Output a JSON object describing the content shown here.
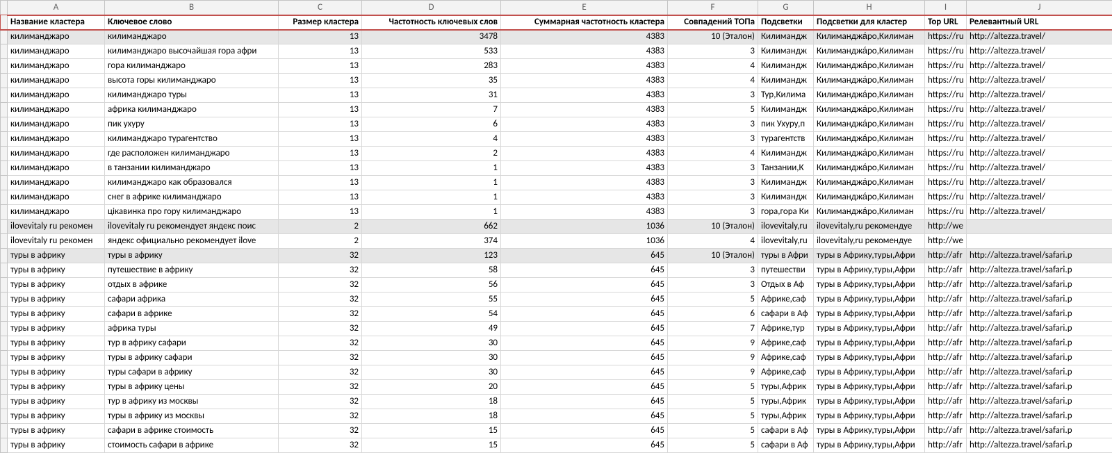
{
  "columns": [
    "A",
    "B",
    "C",
    "D",
    "E",
    "F",
    "G",
    "H",
    "I",
    "J"
  ],
  "headers": {
    "A": "Название кластера",
    "B": "Ключевое слово",
    "C": "Размер кластера",
    "D": "Частотность ключевых слов",
    "E": "Суммарная частотность кластера",
    "F": "Совпадений ТОПа",
    "G": "Подсветки",
    "H": "Подсветки для кластер",
    "I": "Top URL",
    "J": "Релевантный URL"
  },
  "rows": [
    {
      "shade": true,
      "A": "килиманджаро",
      "B": "килиманджаро",
      "C": "13",
      "D": "3478",
      "E": "4383",
      "F": "10 (Эталон)",
      "G": "Килимандж",
      "H": "Килиманджа́ро,Килиман",
      "I": "https://ru",
      "J": "http://altezza.travel/"
    },
    {
      "A": "килиманджаро",
      "B": "килиманджаро высочайшая гора афри",
      "C": "13",
      "D": "533",
      "E": "4383",
      "F": "3",
      "G": "Килимандж",
      "H": "Килиманджа́ро,Килиман",
      "I": "https://ru",
      "J": "http://altezza.travel/"
    },
    {
      "A": "килиманджаро",
      "B": "гора килиманджаро",
      "C": "13",
      "D": "283",
      "E": "4383",
      "F": "4",
      "G": "Килимандж",
      "H": "Килиманджа́ро,Килиман",
      "I": "https://ru",
      "J": "http://altezza.travel/"
    },
    {
      "A": "килиманджаро",
      "B": "высота горы килиманджаро",
      "C": "13",
      "D": "35",
      "E": "4383",
      "F": "4",
      "G": "Килимандж",
      "H": "Килиманджа́ро,Килиман",
      "I": "https://ru",
      "J": "http://altezza.travel/"
    },
    {
      "A": "килиманджаро",
      "B": "килиманджаро туры",
      "C": "13",
      "D": "31",
      "E": "4383",
      "F": "3",
      "G": "Тур,Килима",
      "H": "Килиманджа́ро,Килиман",
      "I": "https://ru",
      "J": "http://altezza.travel/"
    },
    {
      "A": "килиманджаро",
      "B": "африка килиманджаро",
      "C": "13",
      "D": "7",
      "E": "4383",
      "F": "5",
      "G": "Килимандж",
      "H": "Килиманджа́ро,Килиман",
      "I": "https://ru",
      "J": "http://altezza.travel/"
    },
    {
      "A": "килиманджаро",
      "B": "пик ухуру",
      "C": "13",
      "D": "6",
      "E": "4383",
      "F": "3",
      "G": "пик Ухуру,п",
      "H": "Килиманджа́ро,Килиман",
      "I": "https://ru",
      "J": "http://altezza.travel/"
    },
    {
      "A": "килиманджаро",
      "B": "килиманджаро турагентство",
      "C": "13",
      "D": "4",
      "E": "4383",
      "F": "3",
      "G": "турагентств",
      "H": "Килиманджа́ро,Килиман",
      "I": "https://ru",
      "J": "http://altezza.travel/"
    },
    {
      "A": "килиманджаро",
      "B": "где расположен килиманджаро",
      "C": "13",
      "D": "2",
      "E": "4383",
      "F": "4",
      "G": "Килимандж",
      "H": "Килиманджа́ро,Килиман",
      "I": "https://ru",
      "J": "http://altezza.travel/"
    },
    {
      "A": "килиманджаро",
      "B": "в танзании килиманджаро",
      "C": "13",
      "D": "1",
      "E": "4383",
      "F": "3",
      "G": "Танзании,К",
      "H": "Килиманджа́ро,Килиман",
      "I": "https://ru",
      "J": "http://altezza.travel/"
    },
    {
      "A": "килиманджаро",
      "B": "килиманджаро как образовался",
      "C": "13",
      "D": "1",
      "E": "4383",
      "F": "3",
      "G": "Килимандж",
      "H": "Килиманджа́ро,Килиман",
      "I": "https://ru",
      "J": "http://altezza.travel/"
    },
    {
      "A": "килиманджаро",
      "B": "снег в африке килиманджаро",
      "C": "13",
      "D": "1",
      "E": "4383",
      "F": "3",
      "G": "Килимандж",
      "H": "Килиманджа́ро,Килиман",
      "I": "https://ru",
      "J": "http://altezza.travel/"
    },
    {
      "A": "килиманджаро",
      "B": "цікавинка про гору килиманджаро",
      "C": "13",
      "D": "1",
      "E": "4383",
      "F": "3",
      "G": "гора,гора Ки",
      "H": "Килиманджа́ро,Килиман",
      "I": "https://ru",
      "J": "http://altezza.travel/"
    },
    {
      "shade": true,
      "A": "ilovevitaly ru рекомен",
      "B": "ilovevitaly ru рекомендует яндекс поис",
      "C": "2",
      "D": "662",
      "E": "1036",
      "F": "10 (Эталон)",
      "G": "ilovevitaly,ru",
      "H": "ilovevitaly,ru рекомендуе",
      "I": "http://we",
      "J": ""
    },
    {
      "A": "ilovevitaly ru рекомен",
      "B": "яндекс официально рекомендует ilove",
      "C": "2",
      "D": "374",
      "E": "1036",
      "F": "4",
      "G": "ilovevitaly,ru",
      "H": "ilovevitaly,ru рекомендуе",
      "I": "http://we",
      "J": ""
    },
    {
      "shade": true,
      "A": "туры в африку",
      "B": "туры в африку",
      "C": "32",
      "D": "123",
      "E": "645",
      "F": "10 (Эталон)",
      "G": "туры в Афри",
      "H": "туры в Африку,туры,Афри",
      "I": "http://afr",
      "J": "http://altezza.travel/safari.p"
    },
    {
      "A": "туры в африку",
      "B": "путешествие в африку",
      "C": "32",
      "D": "58",
      "E": "645",
      "F": "3",
      "G": "путешестви",
      "H": "туры в Африку,туры,Афри",
      "I": "http://afr",
      "J": "http://altezza.travel/safari.p"
    },
    {
      "A": "туры в африку",
      "B": "отдых в африке",
      "C": "32",
      "D": "56",
      "E": "645",
      "F": "3",
      "G": "Отдых в Аф",
      "H": "туры в Африку,туры,Афри",
      "I": "http://afr",
      "J": "http://altezza.travel/safari.p"
    },
    {
      "A": "туры в африку",
      "B": "сафари африка",
      "C": "32",
      "D": "55",
      "E": "645",
      "F": "5",
      "G": "Африке,саф",
      "H": "туры в Африку,туры,Афри",
      "I": "http://afr",
      "J": "http://altezza.travel/safari.p"
    },
    {
      "A": "туры в африку",
      "B": "сафари в африке",
      "C": "32",
      "D": "54",
      "E": "645",
      "F": "6",
      "G": "сафари в Аф",
      "H": "туры в Африку,туры,Афри",
      "I": "http://afr",
      "J": "http://altezza.travel/safari.p"
    },
    {
      "A": "туры в африку",
      "B": "африка туры",
      "C": "32",
      "D": "49",
      "E": "645",
      "F": "7",
      "G": "Африке,тур",
      "H": "туры в Африку,туры,Афри",
      "I": "http://afr",
      "J": "http://altezza.travel/safari.p"
    },
    {
      "A": "туры в африку",
      "B": "тур в африку сафари",
      "C": "32",
      "D": "30",
      "E": "645",
      "F": "9",
      "G": "Африке,саф",
      "H": "туры в Африку,туры,Афри",
      "I": "http://afr",
      "J": "http://altezza.travel/safari.p"
    },
    {
      "A": "туры в африку",
      "B": "туры в африку сафари",
      "C": "32",
      "D": "30",
      "E": "645",
      "F": "9",
      "G": "Африке,саф",
      "H": "туры в Африку,туры,Афри",
      "I": "http://afr",
      "J": "http://altezza.travel/safari.p"
    },
    {
      "A": "туры в африку",
      "B": "туры сафари в африку",
      "C": "32",
      "D": "30",
      "E": "645",
      "F": "9",
      "G": "Африке,саф",
      "H": "туры в Африку,туры,Афри",
      "I": "http://afr",
      "J": "http://altezza.travel/safari.p"
    },
    {
      "A": "туры в африку",
      "B": "туры в африку цены",
      "C": "32",
      "D": "20",
      "E": "645",
      "F": "5",
      "G": "туры,Африк",
      "H": "туры в Африку,туры,Афри",
      "I": "http://afr",
      "J": "http://altezza.travel/safari.p"
    },
    {
      "A": "туры в африку",
      "B": "тур в африку из москвы",
      "C": "32",
      "D": "18",
      "E": "645",
      "F": "5",
      "G": "туры,Африк",
      "H": "туры в Африку,туры,Афри",
      "I": "http://afr",
      "J": "http://altezza.travel/safari.p"
    },
    {
      "A": "туры в африку",
      "B": "туры в африку из москвы",
      "C": "32",
      "D": "18",
      "E": "645",
      "F": "5",
      "G": "туры,Африк",
      "H": "туры в Африку,туры,Афри",
      "I": "http://afr",
      "J": "http://altezza.travel/safari.p"
    },
    {
      "A": "туры в африку",
      "B": "сафари в африке стоимость",
      "C": "32",
      "D": "15",
      "E": "645",
      "F": "5",
      "G": "сафари в Аф",
      "H": "туры в Африку,туры,Афри",
      "I": "http://afr",
      "J": "http://altezza.travel/safari.p"
    },
    {
      "A": "туры в африку",
      "B": "стоимость сафари в африке",
      "C": "32",
      "D": "15",
      "E": "645",
      "F": "5",
      "G": "сафари в Аф",
      "H": "туры в Африку,туры,Афри",
      "I": "http://afr",
      "J": "http://altezza.travel/safari.p"
    }
  ]
}
